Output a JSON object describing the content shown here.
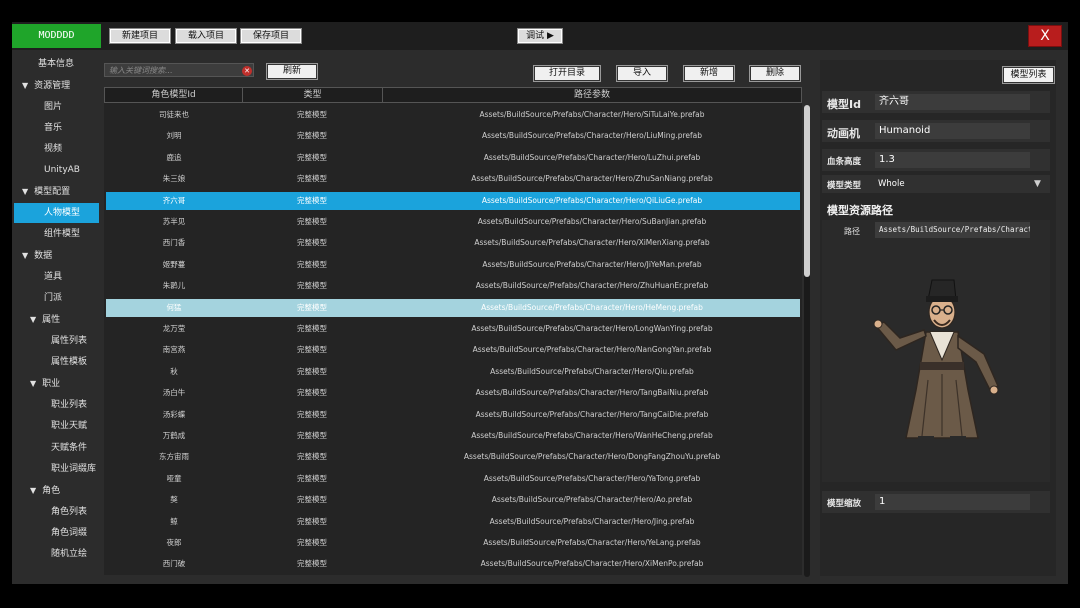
{
  "app_tag": "MODDDD",
  "toolbar": {
    "new_project": "新建项目",
    "load_project": "载入项目",
    "save_project": "保存项目",
    "debug": "调试 ▶",
    "close": "X"
  },
  "sidebar": {
    "items": [
      {
        "label": "基本信息",
        "level": 0,
        "expand": false
      },
      {
        "label": "资源管理",
        "level": 0,
        "expand": true
      },
      {
        "label": "图片",
        "level": 1
      },
      {
        "label": "音乐",
        "level": 1
      },
      {
        "label": "视频",
        "level": 1
      },
      {
        "label": "UnityAB",
        "level": 1
      },
      {
        "label": "模型配置",
        "level": 0,
        "expand": true
      },
      {
        "label": "人物模型",
        "level": 1,
        "active": true
      },
      {
        "label": "组件模型",
        "level": 1
      },
      {
        "label": "数据",
        "level": 0,
        "expand": true
      },
      {
        "label": "道具",
        "level": 1
      },
      {
        "label": "门派",
        "level": 1
      },
      {
        "label": "属性",
        "level": 1,
        "expand": true
      },
      {
        "label": "属性列表",
        "level": 2
      },
      {
        "label": "属性模板",
        "level": 2
      },
      {
        "label": "职业",
        "level": 1,
        "expand": true
      },
      {
        "label": "职业列表",
        "level": 2
      },
      {
        "label": "职业天赋",
        "level": 2
      },
      {
        "label": "天赋条件",
        "level": 2
      },
      {
        "label": "职业词缀库",
        "level": 2
      },
      {
        "label": "角色",
        "level": 1,
        "expand": true
      },
      {
        "label": "角色列表",
        "level": 2
      },
      {
        "label": "角色词缀",
        "level": 2
      },
      {
        "label": "随机立绘",
        "level": 2
      }
    ]
  },
  "search": {
    "placeholder": "输入关键词搜索...",
    "refresh": "刷新"
  },
  "actions": {
    "open_dir": "打开目录",
    "import": "导入",
    "add": "新增",
    "delete": "删除"
  },
  "table": {
    "headers": [
      "角色模型Id",
      "类型",
      "路径参数"
    ],
    "rows": [
      {
        "id": "司徒来也",
        "type": "完整模型",
        "path": "Assets/BuildSource/Prefabs/Character/Hero/SiTuLaiYe.prefab"
      },
      {
        "id": "刘明",
        "type": "完整模型",
        "path": "Assets/BuildSource/Prefabs/Character/Hero/LiuMing.prefab"
      },
      {
        "id": "鹿追",
        "type": "完整模型",
        "path": "Assets/BuildSource/Prefabs/Character/Hero/LuZhui.prefab"
      },
      {
        "id": "朱三娘",
        "type": "完整模型",
        "path": "Assets/BuildSource/Prefabs/Character/Hero/ZhuSanNiang.prefab"
      },
      {
        "id": "齐六哥",
        "type": "完整模型",
        "path": "Assets/BuildSource/Prefabs/Character/Hero/QiLiuGe.prefab",
        "state": "selected"
      },
      {
        "id": "苏半见",
        "type": "完整模型",
        "path": "Assets/BuildSource/Prefabs/Character/Hero/SuBanJian.prefab"
      },
      {
        "id": "西门香",
        "type": "完整模型",
        "path": "Assets/BuildSource/Prefabs/Character/Hero/XiMenXiang.prefab"
      },
      {
        "id": "姬野蔓",
        "type": "完整模型",
        "path": "Assets/BuildSource/Prefabs/Character/Hero/JiYeMan.prefab"
      },
      {
        "id": "朱鹮儿",
        "type": "完整模型",
        "path": "Assets/BuildSource/Prefabs/Character/Hero/ZhuHuanEr.prefab"
      },
      {
        "id": "何猛",
        "type": "完整模型",
        "path": "Assets/BuildSource/Prefabs/Character/Hero/HeMeng.prefab",
        "state": "hover"
      },
      {
        "id": "龙万莹",
        "type": "完整模型",
        "path": "Assets/BuildSource/Prefabs/Character/Hero/LongWanYing.prefab"
      },
      {
        "id": "南宫燕",
        "type": "完整模型",
        "path": "Assets/BuildSource/Prefabs/Character/Hero/NanGongYan.prefab"
      },
      {
        "id": "秋",
        "type": "完整模型",
        "path": "Assets/BuildSource/Prefabs/Character/Hero/Qiu.prefab"
      },
      {
        "id": "汤白牛",
        "type": "完整模型",
        "path": "Assets/BuildSource/Prefabs/Character/Hero/TangBaiNiu.prefab"
      },
      {
        "id": "汤彩蝶",
        "type": "完整模型",
        "path": "Assets/BuildSource/Prefabs/Character/Hero/TangCaiDie.prefab"
      },
      {
        "id": "万鹤成",
        "type": "完整模型",
        "path": "Assets/BuildSource/Prefabs/Character/Hero/WanHeCheng.prefab"
      },
      {
        "id": "东方宙雨",
        "type": "完整模型",
        "path": "Assets/BuildSource/Prefabs/Character/Hero/DongFangZhouYu.prefab"
      },
      {
        "id": "哑童",
        "type": "完整模型",
        "path": "Assets/BuildSource/Prefabs/Character/Hero/YaTong.prefab"
      },
      {
        "id": "獒",
        "type": "完整模型",
        "path": "Assets/BuildSource/Prefabs/Character/Hero/Ao.prefab"
      },
      {
        "id": "鲸",
        "type": "完整模型",
        "path": "Assets/BuildSource/Prefabs/Character/Hero/Jing.prefab"
      },
      {
        "id": "夜郎",
        "type": "完整模型",
        "path": "Assets/BuildSource/Prefabs/Character/Hero/YeLang.prefab"
      },
      {
        "id": "西门破",
        "type": "完整模型",
        "path": "Assets/BuildSource/Prefabs/Character/Hero/XiMenPo.prefab"
      }
    ]
  },
  "detail": {
    "model_list_btn": "模型列表",
    "model_id_label": "模型Id",
    "model_id_value": "齐六哥",
    "animator_label": "动画机",
    "animator_value": "Humanoid",
    "hp_height_label": "血条高度",
    "hp_height_value": "1.3",
    "model_type_label": "模型类型",
    "model_type_value": "Whole",
    "res_path_title": "模型资源路径",
    "path_label": "路径",
    "path_value": "Assets/BuildSource/Prefabs/Character/Hero/QiLiuGe.prefab",
    "scale_label": "模型缩放",
    "scale_value": "1"
  },
  "colors": {
    "accent": "#1ba3dc",
    "hover": "#a4d3de",
    "app_tag": "#1fa52a",
    "close": "#b81d1d"
  }
}
